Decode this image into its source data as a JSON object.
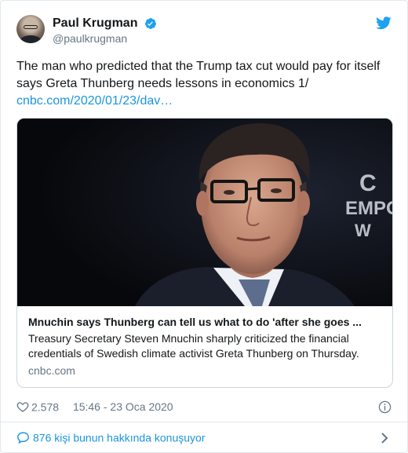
{
  "tweet": {
    "display_name": "Paul Krugman",
    "handle": "@paulkrugman",
    "text_line1": "The man who predicted that the Trump tax cut would pay for itself",
    "text_line2": "says Greta Thunberg needs lessons in economics 1/",
    "link_text": "cnbc.com/2020/01/23/dav…",
    "verified_icon": "verified-badge-icon",
    "logo_icon": "twitter-bird-icon"
  },
  "card": {
    "title": "Mnuchin says Thunberg can tell us what to do 'after she goes ...",
    "description": "Treasury Secretary Steven Mnuchin sharply criticized the financial credentials of Swedish climate activist Greta Thunberg on Thursday.",
    "domain": "cnbc.com",
    "background_text": "C EMPO"
  },
  "meta": {
    "likes": "2.578",
    "timestamp": "15:46 - 23 Oca 2020"
  },
  "footer": {
    "conversation": "876 kişi bunun hakkında konuşuyor"
  },
  "colors": {
    "accent": "#1b95e0",
    "text": "#14171a",
    "muted": "#657786",
    "border": "#e1e8ed"
  }
}
